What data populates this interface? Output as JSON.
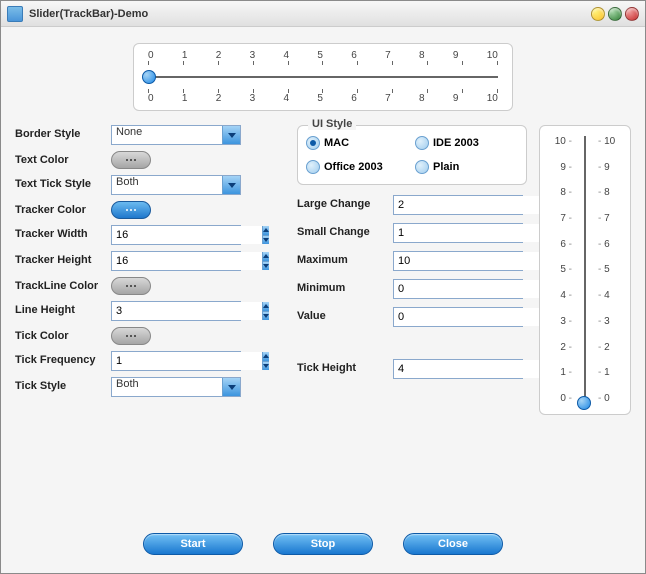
{
  "window": {
    "title": "Slider(TrackBar)-Demo"
  },
  "hslider": {
    "ticks": [
      "0",
      "1",
      "2",
      "3",
      "4",
      "5",
      "6",
      "7",
      "8",
      "9",
      "10"
    ]
  },
  "left": {
    "borderStyle": {
      "label": "Border Style",
      "value": "None"
    },
    "textColor": {
      "label": "Text Color"
    },
    "textTickStyle": {
      "label": "Text Tick Style",
      "value": "Both"
    },
    "trackerColor": {
      "label": "Tracker Color"
    },
    "trackerWidth": {
      "label": "Tracker Width",
      "value": "16"
    },
    "trackerHeight": {
      "label": "Tracker Height",
      "value": "16"
    },
    "trackLineColor": {
      "label": "TrackLine Color"
    },
    "lineHeight": {
      "label": "Line Height",
      "value": "3"
    },
    "tickColor": {
      "label": "Tick Color"
    },
    "tickFrequency": {
      "label": "Tick Frequency",
      "value": "1"
    },
    "tickStyle": {
      "label": "Tick Style",
      "value": "Both"
    }
  },
  "uiStyle": {
    "legend": "UI Style",
    "options": {
      "mac": "MAC",
      "ide2003": "IDE 2003",
      "office2003": "Office 2003",
      "plain": "Plain"
    },
    "selected": "mac"
  },
  "mid": {
    "largeChange": {
      "label": "Large Change",
      "value": "2"
    },
    "smallChange": {
      "label": "Small Change",
      "value": "1"
    },
    "maximum": {
      "label": "Maximum",
      "value": "10"
    },
    "minimum": {
      "label": "Minimum",
      "value": "0"
    },
    "value": {
      "label": "Value",
      "value": "0"
    },
    "tickHeight": {
      "label": "Tick Height",
      "value": "4"
    }
  },
  "vslider": {
    "ticks": [
      "10",
      "9",
      "8",
      "7",
      "6",
      "5",
      "4",
      "3",
      "2",
      "1",
      "0"
    ]
  },
  "buttons": {
    "start": "Start",
    "stop": "Stop",
    "close": "Close"
  }
}
